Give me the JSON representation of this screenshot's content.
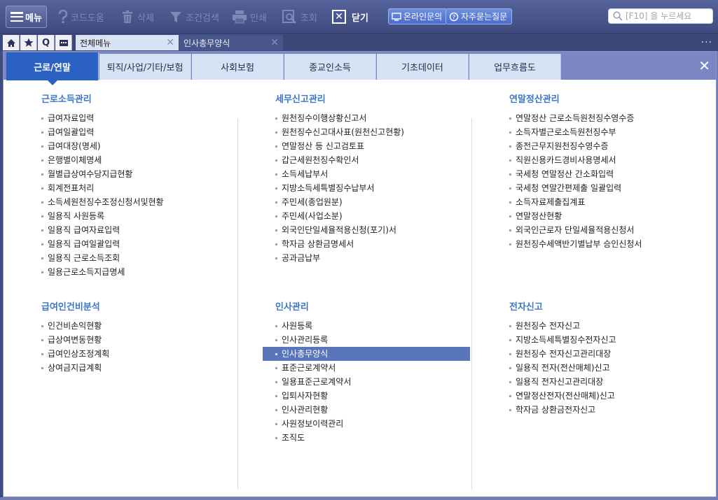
{
  "toolbar": {
    "menu_label": "메뉴",
    "items": [
      {
        "label": "코드도움",
        "icon": "help-icon"
      },
      {
        "label": "삭제",
        "icon": "trash-icon"
      },
      {
        "label": "조건검색",
        "icon": "filter-icon"
      },
      {
        "label": "인쇄",
        "icon": "printer-icon"
      },
      {
        "label": "조회",
        "icon": "search-doc-icon"
      }
    ],
    "close_label": "닫기",
    "online_inquiry": "온라인문의",
    "faq": "자주묻는질문",
    "search_placeholder": "[F10] 을 누르세요"
  },
  "tabstrip": {
    "buttons": [
      "home-icon",
      "star-icon",
      "q-icon",
      "calendar-icon"
    ],
    "q_label": "Q",
    "tabs": [
      {
        "label": "전체메뉴",
        "active": true
      },
      {
        "label": "인사총무양식",
        "active": false
      }
    ],
    "more": "···"
  },
  "categories": [
    "근로/연말",
    "퇴직/사업/기타/보험",
    "사회보험",
    "종교인소득",
    "기초데이터",
    "업무흐름도"
  ],
  "active_category": "근로/연말",
  "close_glyph": "✕",
  "columns": [
    {
      "groups": [
        {
          "title": "근로소득관리",
          "items": [
            "급여자료입력",
            "급여일괄입력",
            "급여대장(명세)",
            "은행별이체명세",
            "월별급상여수당지급현황",
            "회계전표처리",
            "소득세원천징수조정신청서및현황",
            "일용직 사원등록",
            "일용직 급여자료입력",
            "일용직 급여일괄입력",
            "일용직 근로소득조회",
            "일용근로소득지급명세"
          ]
        },
        {
          "title": "급여인건비분석",
          "items": [
            "인건비손익현황",
            "급상여변동현황",
            "급여인상조정계획",
            "상여금지급계획"
          ]
        }
      ]
    },
    {
      "groups": [
        {
          "title": "세무신고관리",
          "items": [
            "원천징수이행상황신고서",
            "원천징수신고대사표(원천신고현황)",
            "연말정산 등 신고검토표",
            "갑근세원천징수확인서",
            "소득세납부서",
            "지방소득세특별징수납부서",
            "주민세(종업원분)",
            "주민세(사업소분)",
            "외국인단일세율적용신청(포기)서",
            "학자금 상환금명세서",
            "공과금납부"
          ]
        },
        {
          "title": "인사관리",
          "items": [
            "사원등록",
            "인사관리등록",
            "인사총무양식",
            "표준근로계약서",
            "일용표준근로계약서",
            "입퇴사자현황",
            "인사관리현황",
            "사원정보이력관리",
            "조직도"
          ],
          "selected": "인사총무양식"
        }
      ]
    },
    {
      "groups": [
        {
          "title": "연말정산관리",
          "items": [
            "연말정산 근로소득원천징수영수증",
            "소득자별근로소득원천징수부",
            "종전근무지원천징수영수증",
            "직원신용카드경비사용명세서",
            "국세청 연말정산 간소화입력",
            "국세청 연말간편제출 일괄입력",
            "소득자료제출집계표",
            "연말정산현황",
            "외국인근로자 단일세율적용신청서",
            "원천징수세액반기별납부 승인신청서"
          ]
        },
        {
          "title": "전자신고",
          "items": [
            "원천징수 전자신고",
            "지방소득세특별징수전자신고",
            "원천징수 전자신고관리대장",
            "일용직 전자(전산매체)신고",
            "일용직 전자신고관리대장",
            "연말정산전자(전산매체)신고",
            "학자금 상환금전자신고"
          ]
        }
      ]
    }
  ]
}
